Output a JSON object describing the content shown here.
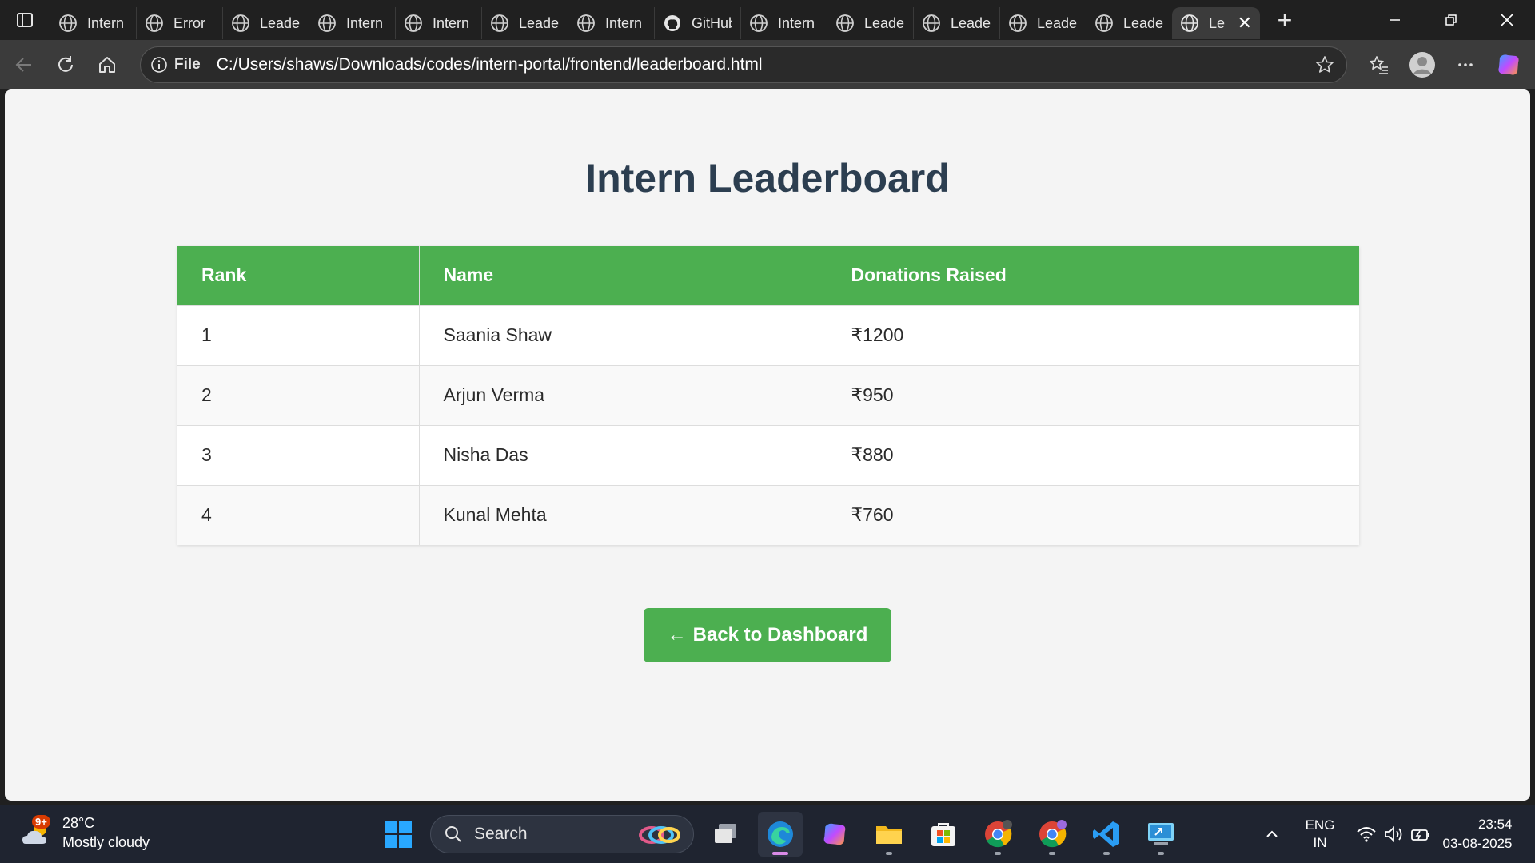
{
  "browser": {
    "tabs": [
      {
        "title": "Intern D",
        "icon": "globe-icon"
      },
      {
        "title": "Error",
        "icon": "globe-icon"
      },
      {
        "title": "Leaderb",
        "icon": "globe-icon"
      },
      {
        "title": "Intern D",
        "icon": "globe-icon"
      },
      {
        "title": "Intern D",
        "icon": "globe-icon"
      },
      {
        "title": "Leaderb",
        "icon": "globe-icon"
      },
      {
        "title": "Intern D",
        "icon": "globe-icon"
      },
      {
        "title": "GitHub",
        "icon": "github-icon"
      },
      {
        "title": "Intern D",
        "icon": "globe-icon"
      },
      {
        "title": "Leaderb",
        "icon": "globe-icon"
      },
      {
        "title": "Leaderb",
        "icon": "globe-icon"
      },
      {
        "title": "Leaderb",
        "icon": "globe-icon"
      },
      {
        "title": "Leaderb",
        "icon": "globe-icon"
      }
    ],
    "active_tab": {
      "title": "Le",
      "icon": "globe-icon"
    },
    "address": {
      "scheme_label": "File",
      "url": "C:/Users/shaws/Downloads/codes/intern-portal/frontend/leaderboard.html"
    }
  },
  "page": {
    "title": "Intern Leaderboard",
    "table": {
      "headers": [
        "Rank",
        "Name",
        "Donations Raised"
      ],
      "rows": [
        [
          "1",
          "Saania Shaw",
          "₹1200"
        ],
        [
          "2",
          "Arjun Verma",
          "₹950"
        ],
        [
          "3",
          "Nisha Das",
          "₹880"
        ],
        [
          "4",
          "Kunal Mehta",
          "₹760"
        ]
      ]
    },
    "back_button": {
      "arrow": "←",
      "label": "Back to Dashboard"
    }
  },
  "taskbar": {
    "weather": {
      "badge": "9+",
      "temp": "28°C",
      "condition": "Mostly cloudy"
    },
    "search_placeholder": "Search",
    "language": {
      "line1": "ENG",
      "line2": "IN"
    },
    "clock": {
      "time": "23:54",
      "date": "03-08-2025"
    }
  },
  "colors": {
    "accent_green": "#4caf50",
    "title": "#2c3e50"
  }
}
